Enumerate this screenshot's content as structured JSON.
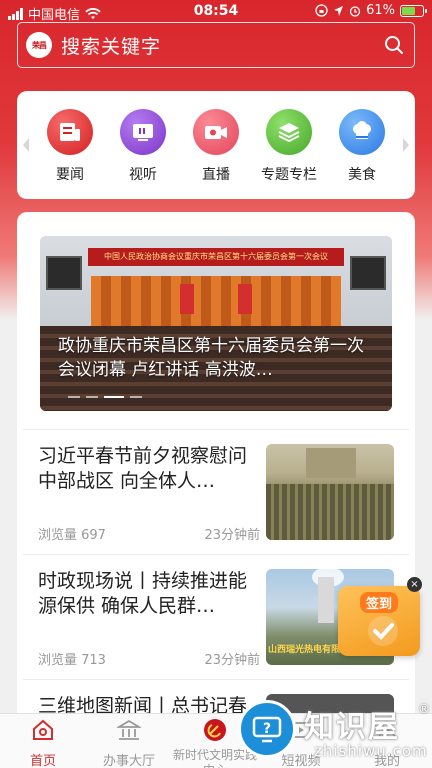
{
  "status_bar": {
    "carrier": "中国电信",
    "time": "08:54",
    "battery": "61%"
  },
  "search": {
    "placeholder": "搜索关键字",
    "logo_text": "荣昌"
  },
  "categories": [
    {
      "label": "要闻",
      "icon": "news-icon",
      "color": "#e53935"
    },
    {
      "label": "视听",
      "icon": "tv-icon",
      "color": "#8e44d6"
    },
    {
      "label": "直播",
      "icon": "camera-icon",
      "color": "#ef5a6a"
    },
    {
      "label": "专题专栏",
      "icon": "layers-icon",
      "color": "#5cc13a"
    },
    {
      "label": "美食",
      "icon": "chef-hat-icon",
      "color": "#3a8ef0"
    }
  ],
  "banner": {
    "caption": "政协重庆市荣昌区第十六届委员会第一次会议闭幕 卢红讲话 高洪波…",
    "backdrop_text": "中国人民政治协商会议重庆市荣昌区第十六届委员会第一次会议"
  },
  "news": [
    {
      "title": "习近平春节前夕视察慰问中部战区 向全体人…",
      "views": "浏览量 697",
      "time": "23分钟前"
    },
    {
      "title": "时政现场说丨持续推进能源保供 确保人民群…",
      "views": "浏览量 713",
      "time": "23分钟前",
      "thumb_caption": "山西瑞光热电有限"
    },
    {
      "title": "三维地图新闻丨总书记春"
    }
  ],
  "signin": {
    "label": "签到",
    "close": "×"
  },
  "tabbar": [
    {
      "label": "首页",
      "active": true
    },
    {
      "label": "办事大厅"
    },
    {
      "label": "新时代文明实践中心"
    },
    {
      "label": "短视频"
    },
    {
      "label": "我的"
    }
  ],
  "watermark": {
    "title": "知识屋",
    "sub": "zhishiwu.com",
    "reg": "®"
  },
  "colors": {
    "brand_red": "#d8262c",
    "active_tab": "#d32f2f"
  }
}
